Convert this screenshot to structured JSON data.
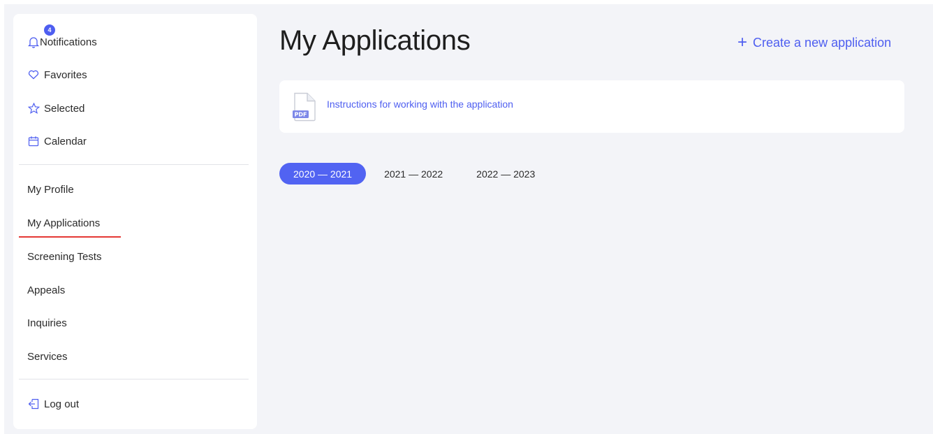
{
  "sidebar": {
    "notifications": {
      "label": "Notifications",
      "badge": "4",
      "icon": "bell-icon"
    },
    "top_items": [
      {
        "label": "Favorites",
        "icon": "heart-icon"
      },
      {
        "label": "Selected",
        "icon": "star-icon"
      },
      {
        "label": "Calendar",
        "icon": "calendar-icon"
      }
    ],
    "nav_items": [
      {
        "label": "My Profile"
      },
      {
        "label": "My Applications",
        "active": true
      },
      {
        "label": "Screening Tests"
      },
      {
        "label": "Appeals"
      },
      {
        "label": "Inquiries"
      },
      {
        "label": "Services"
      }
    ],
    "logout": {
      "label": "Log out",
      "icon": "logout-icon"
    }
  },
  "main": {
    "title": "My Applications",
    "create_link": {
      "label": "Create a new application",
      "icon": "plus-icon"
    },
    "instructions": {
      "label": "Instructions for working with the application",
      "icon": "pdf-file-icon"
    },
    "year_tabs": [
      {
        "label": "2020 — 2021",
        "active": true
      },
      {
        "label": "2021 — 2022",
        "active": false
      },
      {
        "label": "2022 — 2023",
        "active": false
      }
    ]
  },
  "colors": {
    "accent": "#4e5ef0",
    "active_underline": "#e53935",
    "page_background": "#f3f4f8"
  }
}
